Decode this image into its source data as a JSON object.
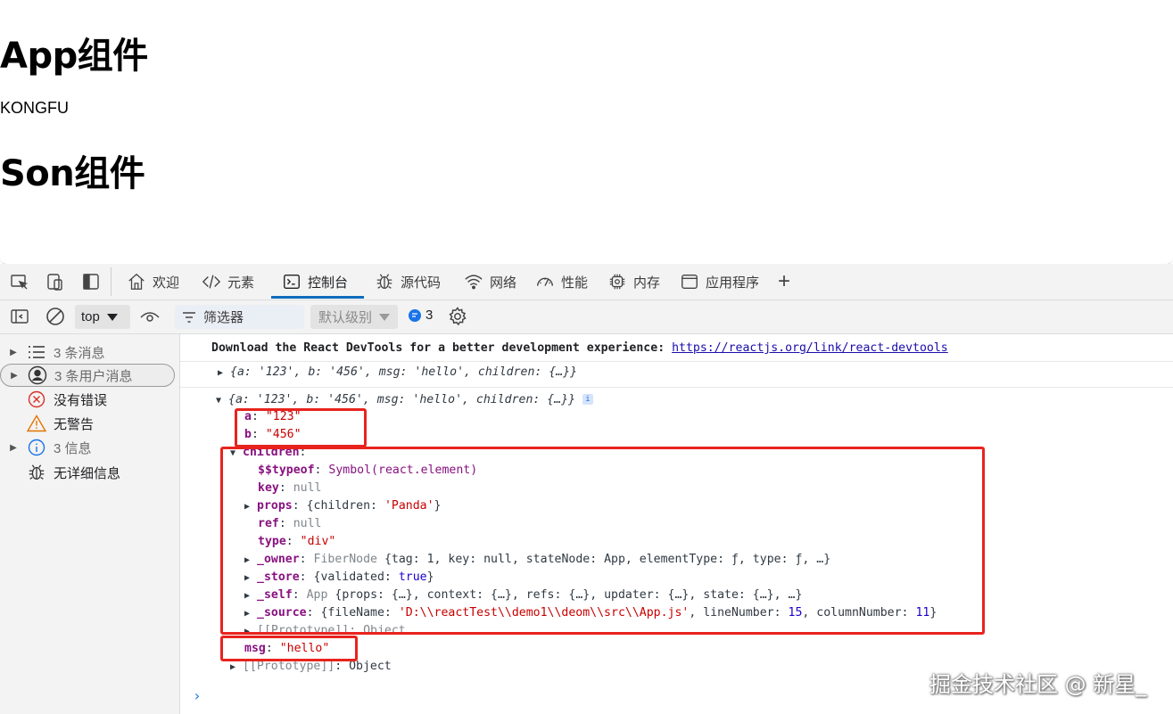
{
  "page": {
    "heading_app": "App组件",
    "text_kongfu": "KONGFU",
    "heading_son": "Son组件"
  },
  "devtools": {
    "tabs": [
      {
        "label": "欢迎",
        "icon": "home-icon"
      },
      {
        "label": "元素",
        "icon": "code-icon"
      },
      {
        "label": "控制台",
        "icon": "console-icon",
        "active": true
      },
      {
        "label": "源代码",
        "icon": "bug-icon"
      },
      {
        "label": "网络",
        "icon": "wifi-icon"
      },
      {
        "label": "性能",
        "icon": "gauge-icon"
      },
      {
        "label": "内存",
        "icon": "chip-icon"
      },
      {
        "label": "应用程序",
        "icon": "window-icon"
      }
    ],
    "add_tab": "+",
    "toolbar": {
      "context": "top",
      "filter_placeholder": "筛选器",
      "level": "默认级别",
      "message_count": "3"
    },
    "sidebar": [
      {
        "label": "3 条消息",
        "icon": "list-icon",
        "expandable": true
      },
      {
        "label": "3 条用户消息",
        "icon": "user-icon",
        "expandable": true,
        "selected": true
      },
      {
        "label": "没有错误",
        "icon": "error-icon"
      },
      {
        "label": "无警告",
        "icon": "warning-icon"
      },
      {
        "label": "3 信息",
        "icon": "info-icon",
        "expandable": true
      },
      {
        "label": "无详细信息",
        "icon": "bug-icon"
      }
    ],
    "console": {
      "banner_text": "Download the React DevTools for a better development experience: ",
      "banner_link": "https://reactjs.org/link/react-devtools",
      "collapsed_obj": "{a: '123', b: '456', msg: 'hello', children: {…}}",
      "expanded_obj": "{a: '123', b: '456', msg: 'hello', children: {…}}",
      "info_badge": "i",
      "a_key": "a",
      "a_val": "\"123\"",
      "b_key": "b",
      "b_val": "\"456\"",
      "children_key": "children",
      "typeof_key": "$$typeof",
      "typeof_val": "Symbol(react.element)",
      "key_key": "key",
      "key_val": "null",
      "props_key": "props",
      "props_open": "{children: ",
      "props_val": "'Panda'",
      "props_close": "}",
      "ref_key": "ref",
      "ref_val": "null",
      "type_key": "type",
      "type_val": "\"div\"",
      "owner_key": "_owner",
      "owner_class": "FiberNode",
      "owner_val": "{tag: 1, key: null, stateNode: App, elementType: ƒ, type: ƒ, …}",
      "store_key": "_store",
      "store_open": "{validated: ",
      "store_val": "true",
      "store_close": "}",
      "self_key": "_self",
      "self_class": "App",
      "self_val": "{props: {…}, context: {…}, refs: {…}, updater: {…}, state: {…}, …}",
      "source_key": "_source",
      "source_open": "{fileName: ",
      "source_file": "'D:\\\\reactTest\\\\demo1\\\\deom\\\\src\\\\App.js'",
      "source_mid1": ", lineNumber: ",
      "source_line": "15",
      "source_mid2": ", columnNumber: ",
      "source_col": "11",
      "source_close": "}",
      "proto_inner": "[[Prototype]]: Object",
      "msg_key": "msg",
      "msg_val": "\"hello\"",
      "proto_key": "[[Prototype]]",
      "proto_val": ": Object",
      "prompt": "›"
    }
  },
  "watermark": "掘金技术社区 @ 新星_"
}
